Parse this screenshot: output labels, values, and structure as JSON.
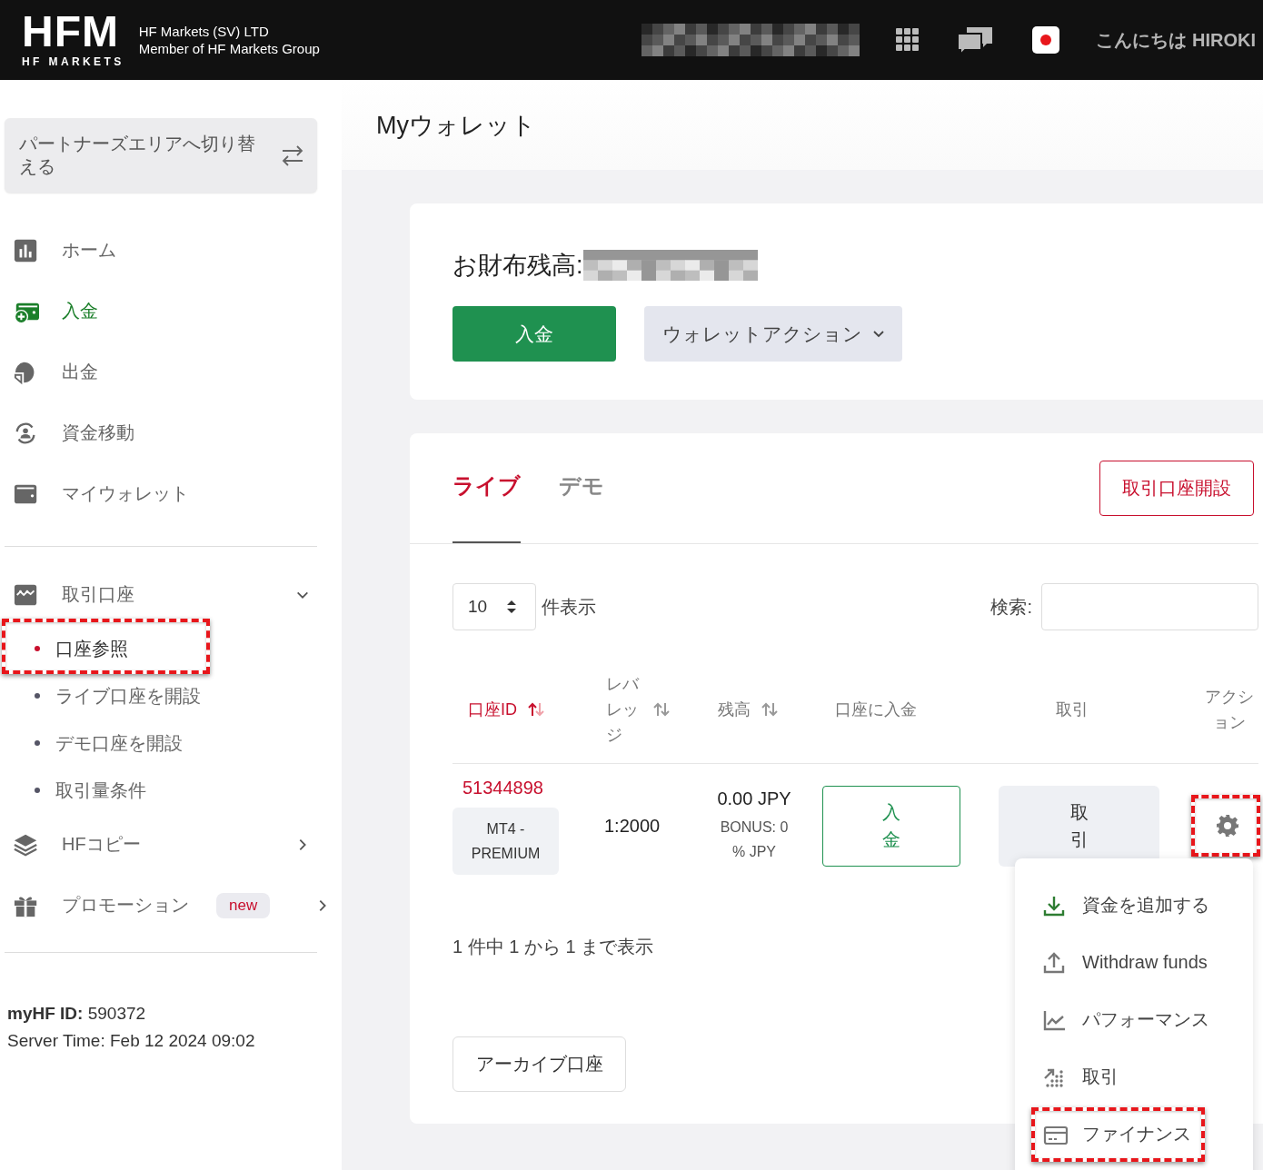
{
  "header": {
    "logo": "HFM",
    "logo_sub": "HF MARKETS",
    "company": "HF Markets (SV) LTD",
    "group": "Member of HF Markets Group",
    "greeting": "こんにちは HIROKI"
  },
  "sidebar": {
    "switch_button": "パートナーズエリアへ切り替える",
    "items": [
      {
        "kind": "home",
        "label": "ホーム"
      },
      {
        "kind": "deposit",
        "label": "入金"
      },
      {
        "kind": "withdraw",
        "label": "出金"
      },
      {
        "kind": "transfer",
        "label": "資金移動"
      },
      {
        "kind": "wallet",
        "label": "マイウォレット"
      },
      {
        "kind": "accounts",
        "label": "取引口座",
        "expanded": true,
        "children": [
          {
            "label": "口座参照",
            "selected": true,
            "highlighted": true
          },
          {
            "label": "ライブ口座を開設",
            "selected": false,
            "highlighted": false
          },
          {
            "label": "デモ口座を開設",
            "selected": false,
            "highlighted": false
          },
          {
            "label": "取引量条件",
            "selected": false,
            "highlighted": false
          }
        ]
      },
      {
        "kind": "copy",
        "label": "HFコピー",
        "expanded": false
      },
      {
        "kind": "promo",
        "label": "プロモーション",
        "expanded": false,
        "badge": "new"
      }
    ],
    "id_label": "myHF ID:",
    "id_value": "590372",
    "server_time": "Server Time: Feb 12 2024 09:02"
  },
  "main": {
    "title": "Myウォレット",
    "wallet": {
      "balance_label": "お財布残高:",
      "deposit_button": "入金",
      "actions_button": "ウォレットアクション"
    },
    "accounts": {
      "tabs": [
        {
          "label": "ライブ",
          "selected": true
        },
        {
          "label": "デモ",
          "selected": false
        }
      ],
      "open_button": "取引口座開設",
      "page_size": "10",
      "page_size_label": "件表示",
      "search_label": "検索:",
      "columns": [
        {
          "label": "口座ID",
          "sortable": true,
          "sorted": true
        },
        {
          "label": "レバレッジ",
          "sortable": true,
          "sorted": false
        },
        {
          "label": "残高",
          "sortable": true,
          "sorted": false
        },
        {
          "label": "口座に入金",
          "sortable": false,
          "sorted": false
        },
        {
          "label": "取引",
          "sortable": false,
          "sorted": false
        },
        {
          "label": "アクション",
          "sortable": false,
          "sorted": false
        }
      ],
      "rows": [
        {
          "account_id": "51344898",
          "platform": "MT4 - PREMIUM",
          "leverage": "1:2000",
          "balance": "0.00 JPY",
          "bonus": "BONUS: 0 % JPY",
          "deposit_button": "入金",
          "trade_button": "取引",
          "action_highlighted": true
        }
      ],
      "summary": "1 件中 1 から 1 まで表示",
      "archive_button": "アーカイブ口座",
      "action_menu": [
        {
          "kind": "add_funds",
          "label": "資金を追加する",
          "highlighted": false
        },
        {
          "kind": "withdraw",
          "label": "Withdraw funds",
          "highlighted": false
        },
        {
          "kind": "performance",
          "label": "パフォーマンス",
          "highlighted": false
        },
        {
          "kind": "trade",
          "label": "取引",
          "highlighted": false
        },
        {
          "kind": "finance",
          "label": "ファイナンス",
          "highlighted": true
        }
      ]
    }
  }
}
